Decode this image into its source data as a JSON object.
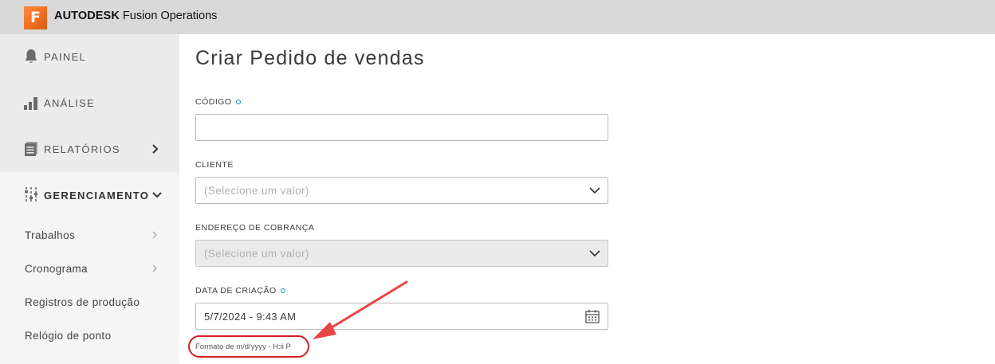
{
  "header": {
    "logo_letter": "F",
    "brand_bold": "AUTODESK",
    "brand_rest": "Fusion Operations",
    "accent_color": "#f26d21"
  },
  "sidebar": {
    "items": [
      {
        "label": "PAINEL",
        "icon": "bell-icon"
      },
      {
        "label": "ANÁLISE",
        "icon": "bar-chart-icon"
      },
      {
        "label": "RELATÓRIOS",
        "icon": "reports-icon",
        "chevron": "chevron-right-icon"
      },
      {
        "label": "GERENCIAMENTO",
        "icon": "sliders-icon",
        "chevron": "chevron-down-icon"
      }
    ],
    "subitems": [
      {
        "label": "Trabalhos",
        "chevron": "chevron-right-icon"
      },
      {
        "label": "Cronograma",
        "chevron": "chevron-right-icon"
      },
      {
        "label": "Registros de produção"
      },
      {
        "label": "Relógio de ponto"
      }
    ]
  },
  "form": {
    "title": "Criar Pedido de vendas",
    "codigo": {
      "label": "CÓDIGO",
      "value": ""
    },
    "cliente": {
      "label": "CLIENTE",
      "placeholder": "(Selecione um valor)"
    },
    "endereco": {
      "label": "ENDEREÇO DE COBRANÇA",
      "placeholder": "(Selecione um valor)"
    },
    "data": {
      "label": "DATA DE CRIAÇÃO",
      "value": "5/7/2024 - 9:43 AM",
      "hint": "Formato de m/d/yyyy - H:ii P"
    }
  },
  "colors": {
    "required_dot": "#0696d7",
    "annotation": "#d81e24",
    "annotation_arrow": "#e84646"
  }
}
